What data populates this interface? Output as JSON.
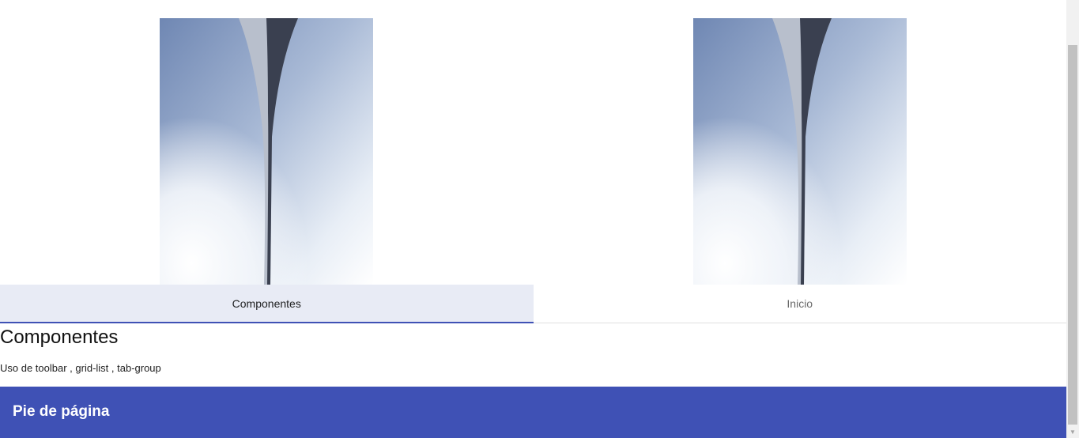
{
  "tabs": {
    "items": [
      {
        "label": "Componentes",
        "active": true,
        "image": "arch-photo"
      },
      {
        "label": "Inicio",
        "active": false,
        "image": "arch-photo"
      }
    ]
  },
  "content": {
    "title": "Componentes",
    "description": "Uso de toolbar , grid-list , tab-group"
  },
  "footer": {
    "title": "Pie de página"
  },
  "colors": {
    "primary": "#3f51b5",
    "active_tab_bg": "#e8ebf5",
    "text": "#222222"
  },
  "icons": {
    "scroll_down": "chevron-down-icon"
  }
}
